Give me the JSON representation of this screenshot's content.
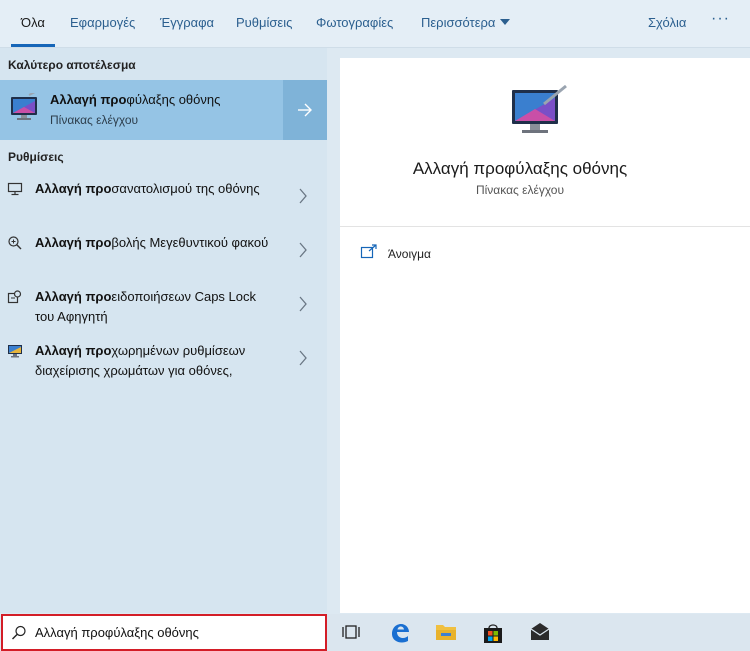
{
  "tabs": [
    "Όλα",
    "Εφαρμογές",
    "Έγγραφα",
    "Ρυθμίσεις",
    "Φωτογραφίες",
    "Περισσότερα"
  ],
  "feedback_label": "Σχόλια",
  "more_options_label": "···",
  "best_match": {
    "section_title": "Καλύτερο αποτέλεσμα",
    "title_bold": "Αλλαγή προ",
    "title_rest": "φύλαξης οθόνης",
    "subtitle": "Πίνακας ελέγχου"
  },
  "settings": {
    "section_title": "Ρυθμίσεις",
    "items": [
      {
        "bold": "Αλλαγή προ",
        "rest": "σανατολισμού της οθόνης",
        "icon": "monitor-icon"
      },
      {
        "bold": "Αλλαγή προ",
        "rest": "βολής Μεγεθυντικού φακού",
        "icon": "magnifier-icon"
      },
      {
        "bold": "Αλλαγή προ",
        "rest": "ειδοποιήσεων Caps Lock του Αφηγητή",
        "icon": "narrator-icon"
      },
      {
        "bold": "Αλλαγή προ",
        "rest": "χωρημένων ρυθμίσεων διαχείρισης χρωμάτων για οθόνες,",
        "icon": "color-management-icon"
      }
    ]
  },
  "preview": {
    "title": "Αλλαγή προφύλαξης οθόνης",
    "subtitle": "Πίνακας ελέγχου",
    "open_label": "Άνοιγμα"
  },
  "search": {
    "query": "Αλλαγή προφύλαξης οθόνης"
  },
  "taskbar_icons": [
    "task-view-icon",
    "edge-icon",
    "file-explorer-icon",
    "store-icon",
    "mail-icon"
  ],
  "colors": {
    "accent": "#1666b8",
    "best_match_bg": "#95c4e5",
    "annotation_red": "#e4141d"
  }
}
